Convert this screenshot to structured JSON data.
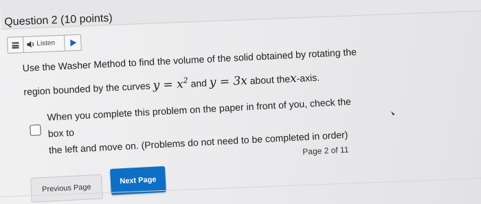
{
  "question": {
    "title": "Question 2 (10 points)"
  },
  "listen": {
    "label": "Listen",
    "menu_icon": "menu-icon",
    "speaker_icon": "speaker-icon",
    "play_icon": "play-icon"
  },
  "problem": {
    "text_start": "Use the Washer Method to find the volume of the solid obtained by rotating the region bounded by the curves",
    "curve1": "y = x",
    "curve1_exp": "2",
    "and": "and",
    "curve2": "y = 3x",
    "text_end": "about the",
    "axis": "x",
    "axis_suffix": "-axis."
  },
  "completion": {
    "line1": "When you complete this problem on the paper in front of you, check the box to",
    "line2": "the left and move on. (Problems do not need to be completed in order)"
  },
  "pagination": {
    "indicator": "Page 2 of 11",
    "previous_label": "Previous Page",
    "next_label": "Next Page"
  },
  "colors": {
    "primary_button": "#0e6fc6",
    "background": "#ebebec"
  }
}
